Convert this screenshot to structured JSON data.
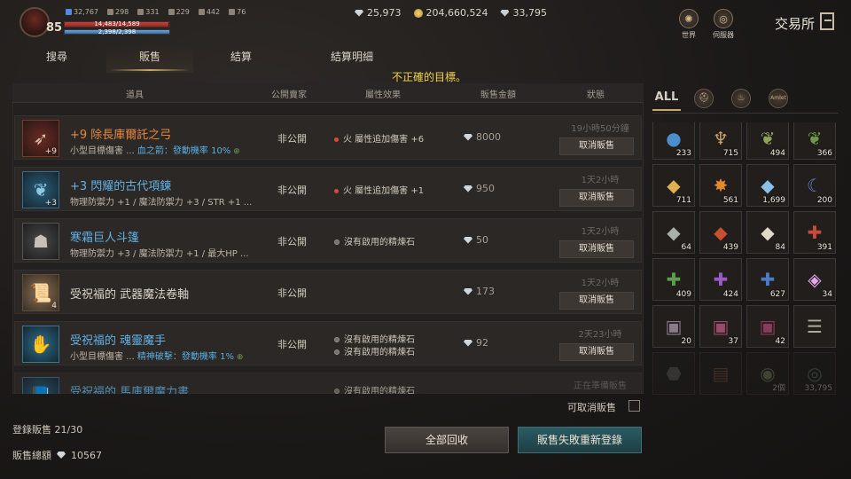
{
  "player": {
    "level": "85",
    "stats": [
      "32,767",
      "298",
      "331",
      "229",
      "442",
      "76"
    ],
    "hp_text": "14,483/14,589",
    "mp_text": "2,398/2,398",
    "hp_fraction": 0.99,
    "mp_fraction": 1.0
  },
  "currency": {
    "diamonds": "25,973",
    "gold": "204,660,524",
    "red_diamonds": "33,795"
  },
  "header": {
    "world_label": "世界",
    "server_label": "伺服器",
    "title": "交易所"
  },
  "tabs": [
    {
      "label": "搜尋"
    },
    {
      "label": "販售"
    },
    {
      "label": "結算"
    },
    {
      "label": "結算明細"
    }
  ],
  "notice": "不正確的目標。",
  "table": {
    "headers": [
      "道具",
      "公開賣家",
      "屬性效果",
      "販售金額",
      "狀態"
    ],
    "rows": [
      {
        "name": "+9 除長庫爾託之弓",
        "sub_prefix": "小型目標傷害 ... ",
        "sub_highlight": "血之箭：發動機率 10%",
        "public": "非公開",
        "effects": [
          "火 屬性追加傷害 +6"
        ],
        "price": "8000",
        "status": "19小時50分鐘",
        "cancel": "取消販售",
        "count": "+9"
      },
      {
        "name": "+3 閃耀的古代項鍊",
        "sub_prefix": "物理防禦力 +1 / 魔法防禦力 +3 / STR +1 ...",
        "sub_highlight": "",
        "public": "非公開",
        "effects": [
          "火 屬性追加傷害 +1"
        ],
        "price": "950",
        "status": "1天2小時",
        "cancel": "取消販售",
        "count": "+3"
      },
      {
        "name": "寒霜巨人斗篷",
        "sub_prefix": "物理防禦力 +3 / 魔法防禦力 +1 / 最大HP ...",
        "sub_highlight": "",
        "public": "非公開",
        "effects": [
          "沒有啟用的精煉石"
        ],
        "price": "50",
        "status": "1天2小時",
        "cancel": "取消販售",
        "count": ""
      },
      {
        "name": "受祝福的 武器魔法卷軸",
        "sub_prefix": "",
        "sub_highlight": "",
        "public": "非公開",
        "effects": [],
        "price": "173",
        "status": "1天2小時",
        "cancel": "取消販售",
        "count": "4"
      },
      {
        "name": "受祝福的 魂靈魔手",
        "sub_prefix": "小型目標傷害 ... ",
        "sub_highlight": "精神破擊：發動機率 1%",
        "public": "非公開",
        "effects": [
          "沒有啟用的精煉石",
          "沒有啟用的精煉石"
        ],
        "price": "92",
        "status": "2天23小時",
        "cancel": "取消販售",
        "count": ""
      },
      {
        "name": "受祝福的 馬庫爾魔力書",
        "sub_prefix": "",
        "sub_highlight": "",
        "public": "",
        "effects": [
          "沒有啟用的精煉石"
        ],
        "price": "",
        "status": "正在準備販售",
        "cancel": "",
        "count": ""
      }
    ]
  },
  "cancelable_label": "可取消販售",
  "summary": {
    "registered": "登錄販售 21/30",
    "total_label": "販售總額",
    "total_value": "10567"
  },
  "buttons": {
    "recall_all": "全部回收",
    "relist_failed": "販售失敗重新登錄"
  },
  "inventory": {
    "tab_all": "ALL",
    "tab_extra": "Amlet",
    "slots": [
      {
        "count": "233",
        "icon": "blue-orb-icon",
        "color": "#4a8fc9"
      },
      {
        "count": "715",
        "icon": "chalice-icon",
        "color": "#c9a06a"
      },
      {
        "count": "494",
        "icon": "leaf-icon",
        "color": "#8fa35a"
      },
      {
        "count": "366",
        "icon": "leaf-icon",
        "color": "#6a9a4a"
      },
      {
        "count": "711",
        "icon": "gold-shard-icon",
        "color": "#e0b050"
      },
      {
        "count": "561",
        "icon": "fire-orb-icon",
        "color": "#e08a30"
      },
      {
        "count": "1,699",
        "icon": "blue-crystal-icon",
        "color": "#8ac0e8"
      },
      {
        "count": "200",
        "icon": "moon-icon",
        "color": "#6a7ad0"
      },
      {
        "count": "64",
        "icon": "gray-shard-icon",
        "color": "#aab0a8"
      },
      {
        "count": "439",
        "icon": "red-shard-icon",
        "color": "#c85030"
      },
      {
        "count": "84",
        "icon": "white-crystal-icon",
        "color": "#e0d8c8"
      },
      {
        "count": "391",
        "icon": "red-cross-icon",
        "color": "#c84a3a"
      },
      {
        "count": "409",
        "icon": "green-cross-icon",
        "color": "#5aa04a"
      },
      {
        "count": "424",
        "icon": "purple-cross-icon",
        "color": "#9a5ac8"
      },
      {
        "count": "627",
        "icon": "blue-cross-icon",
        "color": "#4a7ac8"
      },
      {
        "count": "34",
        "icon": "gem-icon",
        "color": "#e0a8e8"
      },
      {
        "count": "20",
        "icon": "chest-icon",
        "color": "#8a7a8a"
      },
      {
        "count": "37",
        "icon": "chest-icon",
        "color": "#9a4a6a"
      },
      {
        "count": "42",
        "icon": "chest-icon",
        "color": "#8a3a5a"
      },
      {
        "count": "",
        "icon": "scroll-icon",
        "color": "#b0a898"
      },
      {
        "count": "",
        "icon": "ore-icon",
        "color": "#6a6a6a"
      },
      {
        "count": "",
        "icon": "book-icon",
        "color": "#8a5a3a"
      },
      {
        "count": "2個",
        "icon": "coins-icon",
        "color": "#8a9a6a"
      },
      {
        "count": "33,795",
        "icon": "coin-icon",
        "color": "#6a8a7a"
      }
    ]
  }
}
